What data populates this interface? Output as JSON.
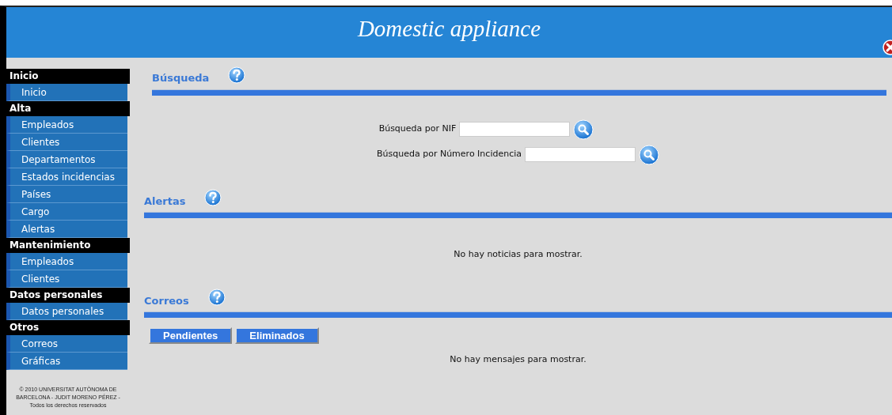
{
  "header": {
    "title": "Domestic appliance"
  },
  "sidebar": {
    "groups": [
      {
        "label": "Inicio",
        "items": [
          "Inicio"
        ]
      },
      {
        "label": "Alta",
        "items": [
          "Empleados",
          "Clientes",
          "Departamentos",
          "Estados incidencias",
          "Países",
          "Cargo",
          "Alertas"
        ]
      },
      {
        "label": "Mantenimiento",
        "items": [
          "Empleados",
          "Clientes"
        ]
      },
      {
        "label": "Datos personales",
        "items": [
          "Datos personales"
        ]
      },
      {
        "label": "Otros",
        "items": [
          "Correos",
          "Gráficas"
        ]
      }
    ],
    "footer": "© 2010 UNIVERSITAT AUTÒNOMA DE BARCELONA - JUDIT MORENO PÉREZ - Todos los derechos reservados"
  },
  "sections": [
    {
      "kind": "search",
      "title": "Búsqueda",
      "fields": [
        {
          "label": "Búsqueda por NIF"
        },
        {
          "label": "Búsqueda por Número Incidencia"
        }
      ]
    },
    {
      "kind": "message",
      "title": "Alertas",
      "message": "No hay noticias para mostrar."
    },
    {
      "kind": "mail",
      "title": "Correos",
      "buttons": [
        "Pendientes",
        "Eliminados"
      ],
      "message": "No hay mensajes para mostrar."
    }
  ]
}
